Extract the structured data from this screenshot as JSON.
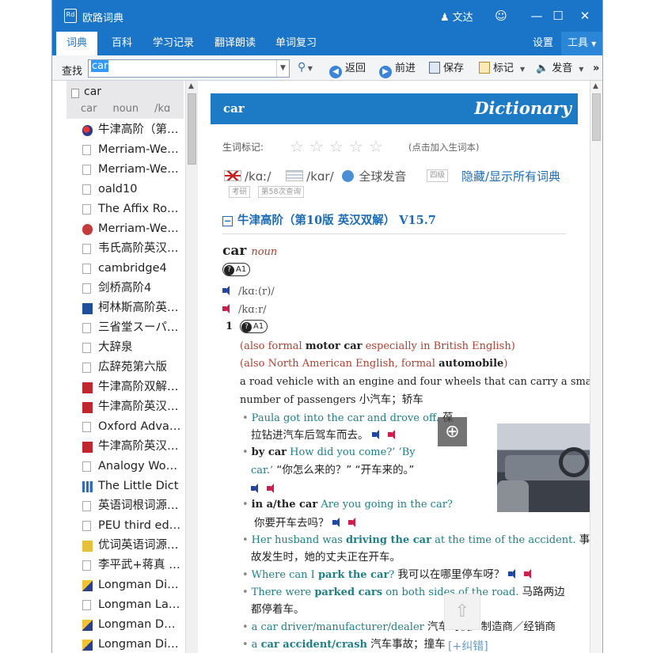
{
  "window": {
    "title": "欧路词典",
    "icon_label": "Rd",
    "user": "文达",
    "controls": [
      "☺",
      "—",
      "☐",
      "✕"
    ]
  },
  "tabs": [
    {
      "label": "词典",
      "active": true
    },
    {
      "label": "百科",
      "active": false
    },
    {
      "label": "学习记录",
      "active": false
    },
    {
      "label": "翻译朗读",
      "active": false
    },
    {
      "label": "单词复习",
      "active": false
    }
  ],
  "right_tabs": {
    "settings": "设置",
    "tools": "工具"
  },
  "searchbar": {
    "label": "查找",
    "query": "car",
    "buttons": {
      "back": "返回",
      "forward": "前进",
      "save": "保存",
      "mark": "标记",
      "speak": "发音"
    },
    "more": "»"
  },
  "word_header": {
    "word": "car",
    "pos": "noun",
    "ipa": "/kɑ"
  },
  "dict_list": [
    {
      "label": "牛津高阶（第…",
      "icon": "oxford-circle-icon"
    },
    {
      "label": "Merriam-We…",
      "icon": "document-icon"
    },
    {
      "label": "Merriam-We…",
      "icon": "document-icon"
    },
    {
      "label": "oald10",
      "icon": "document-icon"
    },
    {
      "label": "The Affix Ro…",
      "icon": "document-icon"
    },
    {
      "label": "Merriam-We…",
      "icon": "merriam-webster-icon"
    },
    {
      "label": "韦氏高阶英汉…",
      "icon": "document-icon"
    },
    {
      "label": "cambridge4",
      "icon": "document-icon"
    },
    {
      "label": "剑桥高阶4",
      "icon": "document-icon"
    },
    {
      "label": "柯林斯高阶英…",
      "icon": "collins-icon"
    },
    {
      "label": "三省堂スーパ…",
      "icon": "document-icon"
    },
    {
      "label": "大辞泉",
      "icon": "document-icon"
    },
    {
      "label": "広辞苑第六版",
      "icon": "document-icon"
    },
    {
      "label": "牛津高阶双解…",
      "icon": "oxford-red-icon"
    },
    {
      "label": "牛津高阶英汉…",
      "icon": "oxford-red-icon"
    },
    {
      "label": "Oxford Adva…",
      "icon": "document-icon"
    },
    {
      "label": "牛津高阶英汉…",
      "icon": "oxford-red-icon"
    },
    {
      "label": "Analogy Wo…",
      "icon": "document-icon"
    },
    {
      "label": "The Little Dict",
      "icon": "bar-chart-icon"
    },
    {
      "label": "英语词根词源…",
      "icon": "document-icon"
    },
    {
      "label": "PEU third ed…",
      "icon": "document-icon"
    },
    {
      "label": "优词英语词源…",
      "icon": "youci-icon"
    },
    {
      "label": "李平武+蒋真 …",
      "icon": "document-icon"
    },
    {
      "label": "Longman Di…",
      "icon": "longman-icon"
    },
    {
      "label": "Longman La…",
      "icon": "document-icon"
    },
    {
      "label": "Longman D…",
      "icon": "longman-icon"
    },
    {
      "label": "Longman Di…",
      "icon": "longman-icon"
    }
  ],
  "entry": {
    "banner_word": "car",
    "banner_title": "Dictionary",
    "mark_label": "生词标记:",
    "stars_filled": 0,
    "stars_total": 5,
    "mark_hint": "(点击加入生词本)",
    "uk_ipa": "/kɑː/",
    "us_ipa": "/kɑr/",
    "global_pron": "全球发音",
    "tag_four": "四级",
    "toggle_all": "隐藏/显示所有词典",
    "tag_kaoyan": "考研",
    "tag_rank": "第58次查询",
    "section_title": "牛津高阶（第10版 英汉双解） V15.7",
    "headword": "car",
    "pos": "noun",
    "cefr": "A1",
    "ipa_uk": "/kɑː(r)/",
    "ipa_us": "/kɑːr/",
    "sense_no": "1",
    "lines": {
      "also1_a": "(also formal ",
      "also1_b": "motor car",
      "also1_c": " especially in British English)",
      "also2_a": "(also North American English, formal ",
      "also2_b": "automobile",
      "also2_c": ")",
      "def_en_1": "a road vehicle with an engine and four wheels that can carry a small",
      "def_en_2": "number of passengers ",
      "def_zh": "小汽车；轿车",
      "ex1_en": "Paula got into the car and drove off.",
      "ex1_zh_a": "葆",
      "ex1_zh_b": "拉钻进汽车后驾车而去。",
      "ex2_b": "by car",
      "ex2_en_a": " How did you come?’ ‘By",
      "ex2_en_b": "car.’",
      "ex2_zh": " “你怎么来的？” “开车来的。”",
      "ex3_b": "in a/the car",
      "ex3_en": " Are you going in the car?",
      "ex3_zh": "你要开车去吗？",
      "ex4_a": "Her husband was ",
      "ex4_b": "driving the car",
      "ex4_c": " at the time of the accident.",
      "ex4_zh_a": "事",
      "ex4_zh_b": "故发生时，她的丈夫正在开车。",
      "ex5_a": "Where can I ",
      "ex5_b": "park the car",
      "ex5_c": "?",
      "ex5_zh": "我可以在哪里停车呀？",
      "ex6_a": "There were ",
      "ex6_b": "parked cars",
      "ex6_c": " on both sides of the road.",
      "ex6_zh_a": "马路两边",
      "ex6_zh_b": "都停着车。",
      "ex7_en": "a car driver/manufacturer/dealer",
      "ex7_zh": "汽车司机／制造商／经销商",
      "ex8_a": "a ",
      "ex8_b": "car accident/crash",
      "ex8_zh": "汽车事故；撞车"
    },
    "feedback": "[+纠错]"
  },
  "colors": {
    "accent": "#1a75c8",
    "teal": "#1e7f86",
    "brown": "#b0402f"
  }
}
